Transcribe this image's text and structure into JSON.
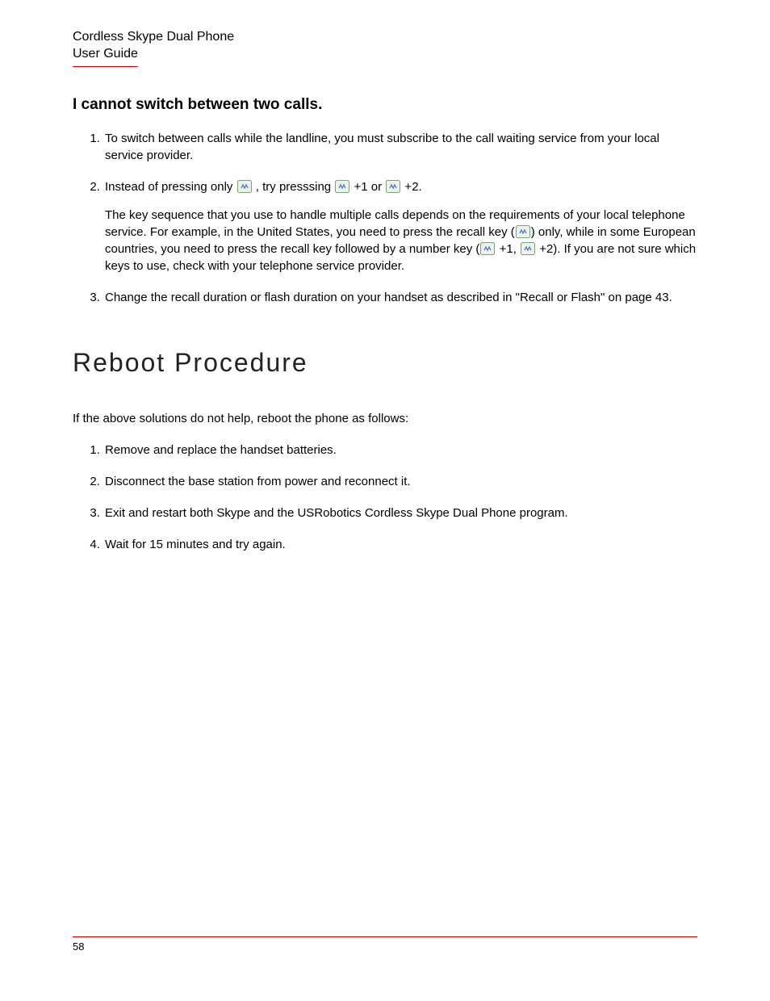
{
  "header": {
    "line1": "Cordless Skype Dual Phone",
    "line2": "User Guide"
  },
  "section1": {
    "heading": "I cannot switch between two calls.",
    "item1": "To switch between calls while the landline, you must subscribe to the call waiting service from your local service provider.",
    "item2": {
      "a": "Instead of pressing only ",
      "b": " , try presssing ",
      "c": " +1 or ",
      "d": " +2."
    },
    "item2_para": {
      "a": "The key sequence that you use to handle multiple calls depends on the requirements of your local telephone service. For example, in the United States, you need to press the recall key (",
      "b": ") only, while in some European countries, you need to press the recall key followed by a number key (",
      "c": " +1, ",
      "d": " +2). If you are not sure which keys to use, check with your telephone service provider."
    },
    "item3": "Change the recall duration or flash duration on your handset as described in \"Recall or Flash\" on page 43."
  },
  "section2": {
    "heading": "Reboot Procedure",
    "intro": "If the above solutions do not help, reboot the phone as follows:",
    "steps": {
      "s1": "Remove and replace the handset batteries.",
      "s2": "Disconnect the base station from power and reconnect it.",
      "s3": "Exit and restart both Skype and the USRobotics Cordless Skype Dual Phone program.",
      "s4": "Wait for 15 minutes and try again."
    }
  },
  "footer": {
    "page_number": "58"
  }
}
